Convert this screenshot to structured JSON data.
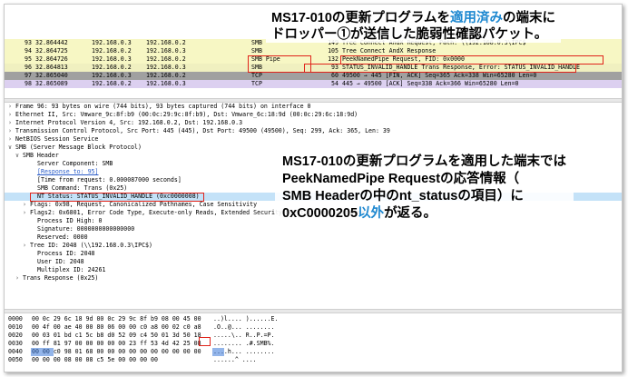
{
  "packets": [
    {
      "no": "93",
      "time": "32.864442",
      "src": "192.168.0.3",
      "dst": "192.168.0.2",
      "proto": "SMB",
      "len": "149",
      "info": "Tree Connect AndX Request, Path: \\\\192.168.0.3\\IPC$",
      "bg": "#f7f7c4"
    },
    {
      "no": "94",
      "time": "32.864725",
      "src": "192.168.0.2",
      "dst": "192.168.0.3",
      "proto": "SMB",
      "len": "105",
      "info": "Tree Connect AndX Response",
      "bg": "#f7f7c4"
    },
    {
      "no": "95",
      "time": "32.864726",
      "src": "192.168.0.3",
      "dst": "192.168.0.2",
      "proto": "SMB Pipe",
      "len": "132",
      "info": "PeekNamedPipe Request, FID: 0x0000",
      "bg": "#f7f7c4"
    },
    {
      "no": "96",
      "time": "32.864813",
      "src": "192.168.0.2",
      "dst": "192.168.0.3",
      "proto": "SMB",
      "len": "93",
      "info": "STATUS_INVALID_HANDLE  Trans Response, Error: STATUS_INVALID_HANDLE",
      "bg": "#f0f0c0"
    },
    {
      "no": "97",
      "time": "32.865040",
      "src": "192.168.0.3",
      "dst": "192.168.0.2",
      "proto": "TCP",
      "len": "60",
      "info": "49500 → 445 [FIN, ACK] Seq=365 Ack=338 Win=65280 Len=0",
      "bg": "#a0a0a0"
    },
    {
      "no": "98",
      "time": "32.865089",
      "src": "192.168.0.2",
      "dst": "192.168.0.3",
      "proto": "TCP",
      "len": "54",
      "info": "445 → 49500 [ACK] Seq=338 Ack=366 Win=65280 Len=0",
      "bg": "#dcd0f0"
    }
  ],
  "details": [
    {
      "text": "Frame 96: 93 bytes on wire (744 bits), 93 bytes captured (744 bits) on interface 0",
      "arrow": ">",
      "indent": 0
    },
    {
      "text": "Ethernet II, Src: Vmware_9c:8f:b9 (00:0c:29:9c:8f:b9), Dst: Vmware_6c:18:9d (00:0c:29:6c:18:9d)",
      "arrow": ">",
      "indent": 0
    },
    {
      "text": "Internet Protocol Version 4, Src: 192.168.0.2, Dst: 192.168.0.3",
      "arrow": ">",
      "indent": 0
    },
    {
      "text": "Transmission Control Protocol, Src Port: 445 (445), Dst Port: 49500 (49500), Seq: 299, Ack: 365, Len: 39",
      "arrow": ">",
      "indent": 0
    },
    {
      "text": "NetBIOS Session Service",
      "arrow": ">",
      "indent": 0
    },
    {
      "text": "SMB (Server Message Block Protocol)",
      "arrow": "v",
      "indent": 0
    },
    {
      "text": "SMB Header",
      "arrow": "v",
      "indent": 1
    },
    {
      "text": "Server Component: SMB",
      "arrow": "",
      "indent": 3
    },
    {
      "text": "[Response to: 95]",
      "arrow": "",
      "indent": 3,
      "link": true
    },
    {
      "text": "[Time from request: 0.000087000 seconds]",
      "arrow": "",
      "indent": 3
    },
    {
      "text": "SMB Command: Trans (0x25)",
      "arrow": "",
      "indent": 3
    },
    {
      "text": "NT Status: STATUS_INVALID_HANDLE (0xc0000008)",
      "arrow": "",
      "indent": 3,
      "hl": true
    },
    {
      "text": "Flags: 0x98, Request, Canonicalized Pathnames, Case Sensitivity",
      "arrow": ">",
      "indent": 2
    },
    {
      "text": "Flags2: 0x6801, Error Code Type, Execute-only Reads, Extended Security Negotiation, Long Names Allowed",
      "arrow": ">",
      "indent": 2
    },
    {
      "text": "Process ID High: 0",
      "arrow": "",
      "indent": 3
    },
    {
      "text": "Signature: 0000000000000000",
      "arrow": "",
      "indent": 3
    },
    {
      "text": "Reserved: 0000",
      "arrow": "",
      "indent": 3
    },
    {
      "text": "Tree ID: 2048  (\\\\192.168.0.3\\IPC$)",
      "arrow": ">",
      "indent": 2
    },
    {
      "text": "Process ID: 2048",
      "arrow": "",
      "indent": 3
    },
    {
      "text": "User ID: 2048",
      "arrow": "",
      "indent": 3
    },
    {
      "text": "Multiplex ID: 24261",
      "arrow": "",
      "indent": 3
    },
    {
      "text": "Trans Response (0x25)",
      "arrow": ">",
      "indent": 1
    }
  ],
  "hex": [
    {
      "off": "0000",
      "bytes": "00 0c 29 6c 18 9d 00 0c  29 9c 8f b9 08 00 45 00",
      "ascii": "..)l....  )......E."
    },
    {
      "off": "0010",
      "bytes": "00 4f 00 ae 40 00 80 06  00 00 c0 a8 00 02 c0 a8",
      "ascii": ".O..@...  ........"
    },
    {
      "off": "0020",
      "bytes": "00 03 01 bd c1 5c b8 d0  52 09 c4 50 01 3d 50 18",
      "ascii": ".....\\..  R..P.=P."
    },
    {
      "off": "0030",
      "bytes": "00 ff 81 97 00 00 00 00  00 23 ff 53 4d 42 25 08",
      "ascii": "........  .#.SMB%."
    },
    {
      "off": "0040",
      "bytes": "00 00 c0 98 01 68 00 00  00 00 00 00 00 00 00 00",
      "ascii": "....h...  ........"
    },
    {
      "off": "0050",
      "bytes": "00 00 00 08 00 08 c5 5e  00 00 00 00",
      "ascii": "......^  ...."
    }
  ],
  "callout1": {
    "line1_a": "MS17-010の更新プログラムを",
    "line1_b": "適用済み",
    "line1_c": "の端末に",
    "line2": "ドロッパー①が送信した脆弱性確認パケット。"
  },
  "callout2": {
    "line1": "MS17-010の更新プログラムを適用した端末では",
    "line2": "PeekNamedPipe Requestの応答情報（",
    "line3": "SMB Headerの中のnt_statusの項目）に",
    "line4_a": "0xC0000205",
    "line4_b": "以外",
    "line4_c": "が返る。"
  },
  "colors": {
    "accent_blue": "#1e88d0",
    "highlight": "#c4e2f8",
    "red_box": "#e0231a",
    "hex_select": "#3a78d8"
  }
}
